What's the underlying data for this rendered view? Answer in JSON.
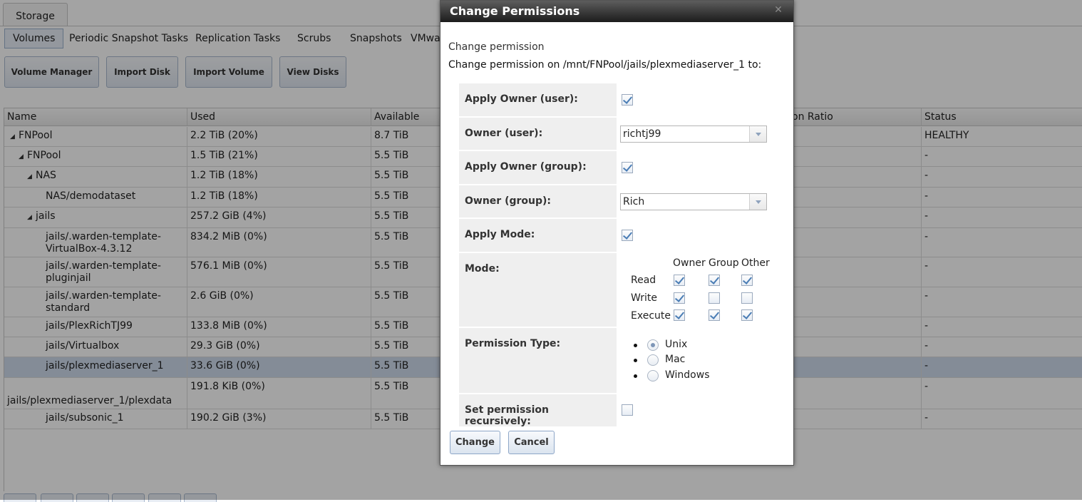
{
  "top_tab": "Storage",
  "subtabs": [
    "Volumes",
    "Periodic Snapshot Tasks",
    "Replication Tasks",
    "Scrubs",
    "Snapshots",
    "VMwa"
  ],
  "toolbar": [
    "Volume Manager",
    "Import Disk",
    "Import Volume",
    "View Disks"
  ],
  "table": {
    "headers": [
      "Name",
      "Used",
      "Available",
      "on Ratio",
      "Status"
    ],
    "rows": [
      {
        "name": "FNPool",
        "used": "2.2 TiB (20%)",
        "available": "8.7 TiB",
        "status": "HEALTHY"
      },
      {
        "name": "FNPool",
        "used": "1.5 TiB (21%)",
        "available": "5.5 TiB",
        "status": "-"
      },
      {
        "name": "NAS",
        "used": "1.2 TiB (18%)",
        "available": "5.5 TiB",
        "status": "-"
      },
      {
        "name": "NAS/demodataset",
        "used": "1.2 TiB (18%)",
        "available": "5.5 TiB",
        "status": "-"
      },
      {
        "name": "jails",
        "used": "257.2 GiB (4%)",
        "available": "5.5 TiB",
        "status": "-"
      },
      {
        "name": "jails/.warden-template-",
        "name2": "VirtualBox-4.3.12",
        "used": "834.2 MiB (0%)",
        "available": "5.5 TiB",
        "status": "-"
      },
      {
        "name": "jails/.warden-template-",
        "name2": "pluginjail",
        "used": "576.1 MiB (0%)",
        "available": "5.5 TiB",
        "status": "-"
      },
      {
        "name": "jails/.warden-template-",
        "name2": "standard",
        "used": "2.6 GiB (0%)",
        "available": "5.5 TiB",
        "status": "-"
      },
      {
        "name": "jails/PlexRichTJ99",
        "used": "133.8 MiB (0%)",
        "available": "5.5 TiB",
        "status": "-"
      },
      {
        "name": "jails/Virtualbox",
        "used": "29.3 GiB (0%)",
        "available": "5.5 TiB",
        "status": "-"
      },
      {
        "name": "jails/plexmediaserver_1",
        "used": "33.6 GiB (0%)",
        "available": "5.5 TiB",
        "status": "-"
      },
      {
        "name": "jails/plexmediaserver_1/plexdata",
        "used": "191.8 KiB (0%)",
        "available": "5.5 TiB",
        "status": "-"
      },
      {
        "name": "jails/subsonic_1",
        "used": "190.2 GiB (3%)",
        "available": "5.5 TiB",
        "status": "-"
      }
    ]
  },
  "dialog": {
    "title": "Change Permissions",
    "close": "✕",
    "heading": "Change permission",
    "subtitle": "Change permission on /mnt/FNPool/jails/plexmediaserver_1 to:",
    "apply_owner_user_label": "Apply Owner (user):",
    "apply_owner_user_checked": true,
    "owner_user_label": "Owner (user):",
    "owner_user_value": "richtj99",
    "apply_owner_group_label": "Apply Owner (group):",
    "apply_owner_group_checked": true,
    "owner_group_label": "Owner (group):",
    "owner_group_value": "Rich",
    "apply_mode_label": "Apply Mode:",
    "apply_mode_checked": true,
    "mode_label": "Mode:",
    "mode": {
      "columns": [
        "Owner",
        "Group",
        "Other"
      ],
      "rows": [
        "Read",
        "Write",
        "Execute"
      ],
      "values": [
        [
          true,
          true,
          true
        ],
        [
          true,
          false,
          false
        ],
        [
          true,
          true,
          true
        ]
      ]
    },
    "permission_type_label": "Permission Type:",
    "permission_types": [
      "Unix",
      "Mac",
      "Windows"
    ],
    "permission_type_selected": "Unix",
    "recursive_label": "Set permission recursively:",
    "recursive_checked": false,
    "change_button": "Change",
    "cancel_button": "Cancel"
  }
}
